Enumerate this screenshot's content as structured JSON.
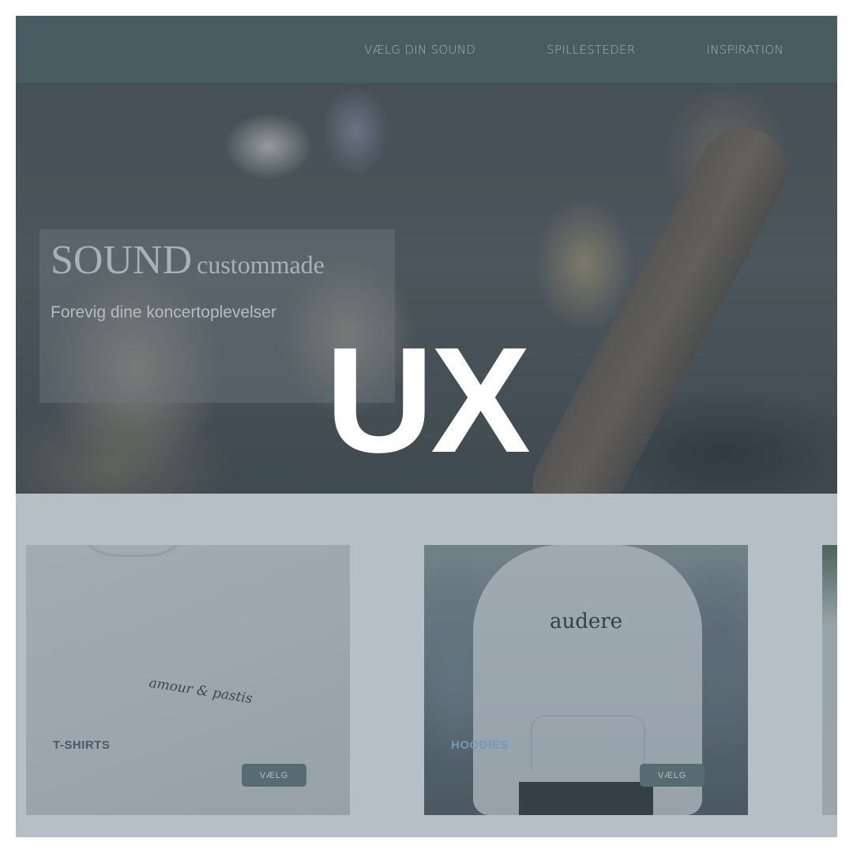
{
  "nav": {
    "links": [
      "VÆLG DIN SOUND",
      "SPILLESTEDER",
      "INSPIRATION"
    ]
  },
  "hero": {
    "title_main": "SOUND",
    "title_accent": "custommade",
    "subtitle": "Forevig dine koncertoplevelser"
  },
  "overlay": {
    "text": "UX"
  },
  "products": {
    "cards": [
      {
        "label": "T-SHIRTS",
        "print": "amour & pastis",
        "button": "VÆLG"
      },
      {
        "label": "HOODIES",
        "print": "audere",
        "button": "VÆLG"
      }
    ]
  },
  "colors": {
    "nav_bg": "#4d5f62",
    "button_bg": "#5f7476",
    "section_bg": "#d9dde2"
  }
}
